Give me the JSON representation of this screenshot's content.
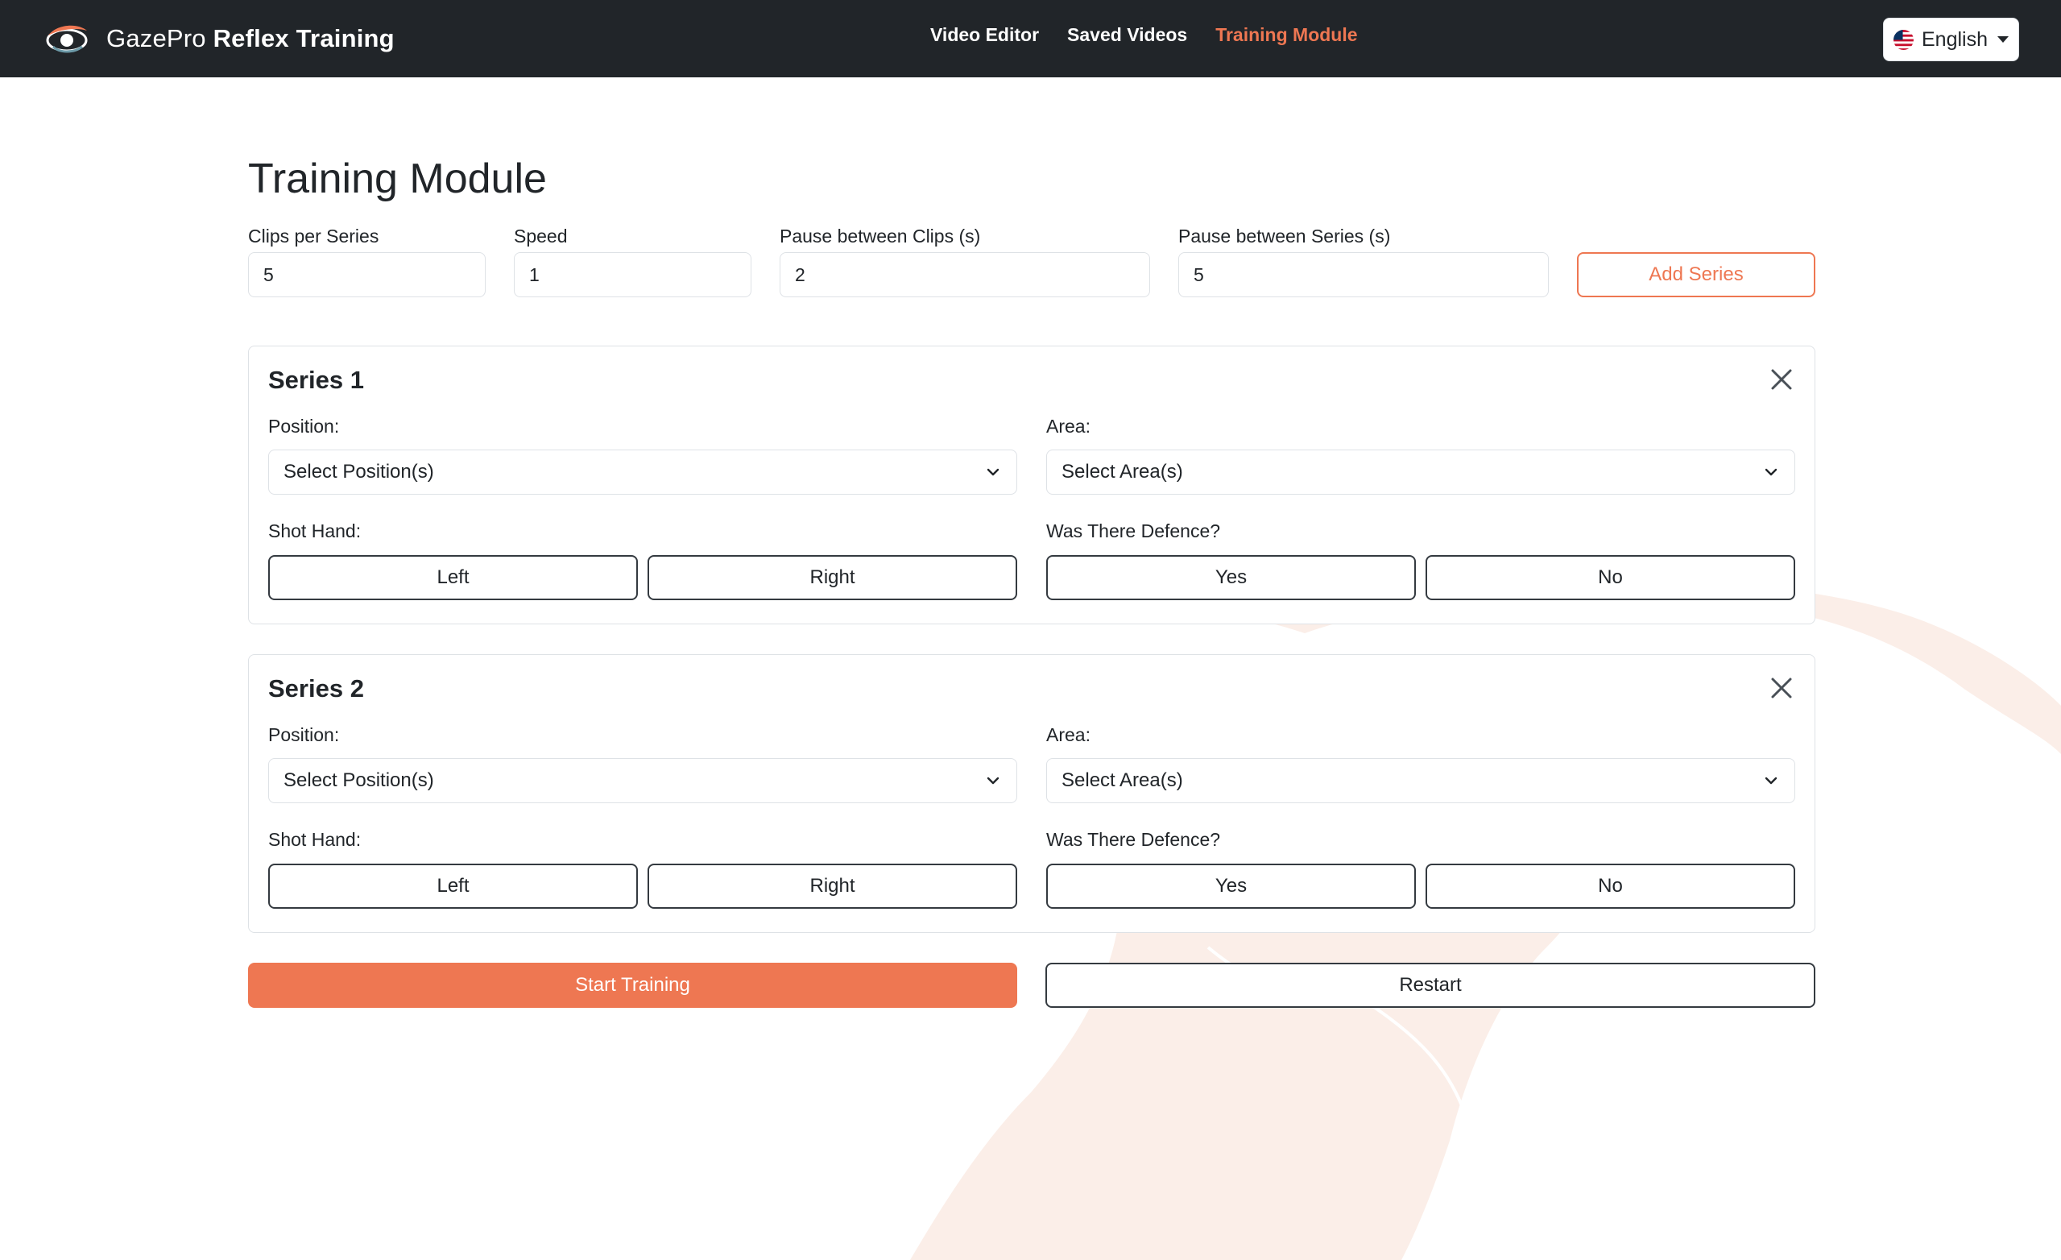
{
  "navbar": {
    "brand_light": "GazePro",
    "brand_bold": "Reflex Training",
    "links": [
      {
        "label": "Video Editor",
        "active": false
      },
      {
        "label": "Saved Videos",
        "active": false
      },
      {
        "label": "Training Module",
        "active": true
      }
    ],
    "language": {
      "label": "English",
      "flag_icon": "us-flag-icon"
    }
  },
  "page": {
    "title": "Training Module"
  },
  "settings": {
    "clips_per_series": {
      "label": "Clips per Series",
      "value": "5"
    },
    "speed": {
      "label": "Speed",
      "value": "1"
    },
    "pause_between_clips": {
      "label": "Pause between Clips (s)",
      "value": "2"
    },
    "pause_between_series": {
      "label": "Pause between Series (s)",
      "value": "5"
    },
    "add_series_label": "Add Series"
  },
  "series": [
    {
      "title": "Series 1",
      "position_label": "Position:",
      "position_value": "Select Position(s)",
      "area_label": "Area:",
      "area_value": "Select Area(s)",
      "shot_hand_label": "Shot Hand:",
      "shot_hand_options": [
        "Left",
        "Right"
      ],
      "defence_label": "Was There Defence?",
      "defence_options": [
        "Yes",
        "No"
      ]
    },
    {
      "title": "Series 2",
      "position_label": "Position:",
      "position_value": "Select Position(s)",
      "area_label": "Area:",
      "area_value": "Select Area(s)",
      "shot_hand_label": "Shot Hand:",
      "shot_hand_options": [
        "Left",
        "Right"
      ],
      "defence_label": "Was There Defence?",
      "defence_options": [
        "Yes",
        "No"
      ]
    }
  ],
  "actions": {
    "start_label": "Start Training",
    "restart_label": "Restart"
  },
  "colors": {
    "accent": "#ee7752",
    "navbar_bg": "#212529",
    "watermark": "#fbeee8"
  }
}
